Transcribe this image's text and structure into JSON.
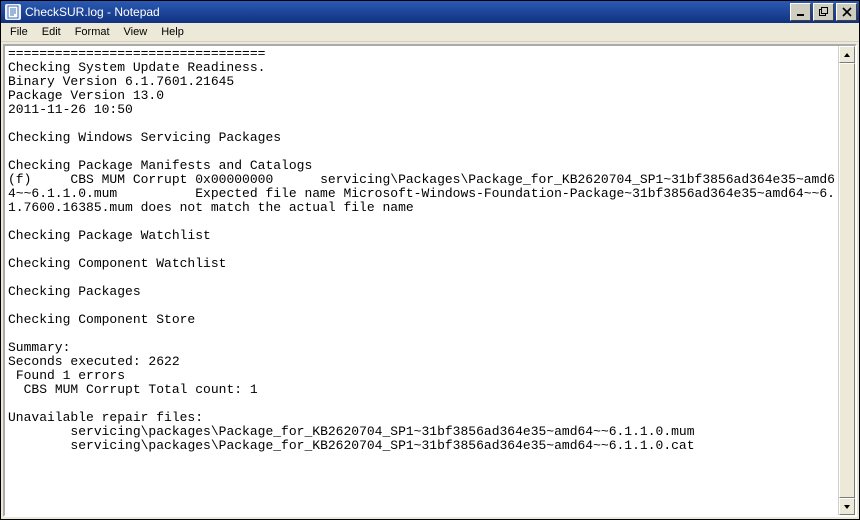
{
  "window": {
    "title": "CheckSUR.log - Notepad"
  },
  "menu": {
    "file": "File",
    "edit": "Edit",
    "format": "Format",
    "view": "View",
    "help": "Help"
  },
  "document": {
    "content": "=================================\nChecking System Update Readiness.\nBinary Version 6.1.7601.21645\nPackage Version 13.0\n2011-11-26 10:50\n\nChecking Windows Servicing Packages\n\nChecking Package Manifests and Catalogs\n(f)\tCBS MUM Corrupt\t0x00000000\tservicing\\Packages\\Package_for_KB2620704_SP1~31bf3856ad364e35~amd64~~6.1.1.0.mum\t\tExpected file name Microsoft-Windows-Foundation-Package~31bf3856ad364e35~amd64~~6.1.7600.16385.mum does not match the actual file name\n\nChecking Package Watchlist\n\nChecking Component Watchlist\n\nChecking Packages\n\nChecking Component Store\n\nSummary:\nSeconds executed: 2622\n Found 1 errors\n  CBS MUM Corrupt Total count: 1\n\nUnavailable repair files:\n\tservicing\\packages\\Package_for_KB2620704_SP1~31bf3856ad364e35~amd64~~6.1.1.0.mum\n\tservicing\\packages\\Package_for_KB2620704_SP1~31bf3856ad364e35~amd64~~6.1.1.0.cat\n"
  }
}
